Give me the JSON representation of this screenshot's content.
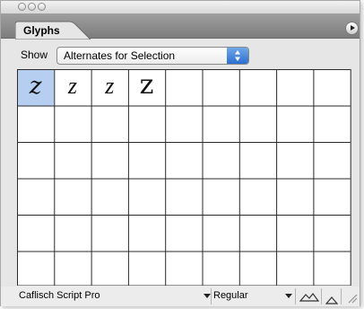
{
  "panel": {
    "tab_label": "Glyphs",
    "show_label": "Show",
    "show_select_value": "Alternates for Selection",
    "font_family": "Caflisch Script Pro",
    "font_style": "Regular",
    "glyphs": [
      "z",
      "z",
      "z",
      "z"
    ],
    "selected_index": 0
  },
  "colors": {
    "selected_cell": "#b6cff1",
    "select_stepper": "#2d6fd0",
    "grid_line": "#2a2a2a"
  },
  "icons": [
    "close-circle-icon",
    "minimize-circle-icon",
    "zoom-circle-icon",
    "panel-menu-icon",
    "select-stepper-icon",
    "dropdown-arrow-icon",
    "zoom-out-mountain-icon",
    "zoom-in-mountain-icon",
    "resize-grip-icon"
  ]
}
